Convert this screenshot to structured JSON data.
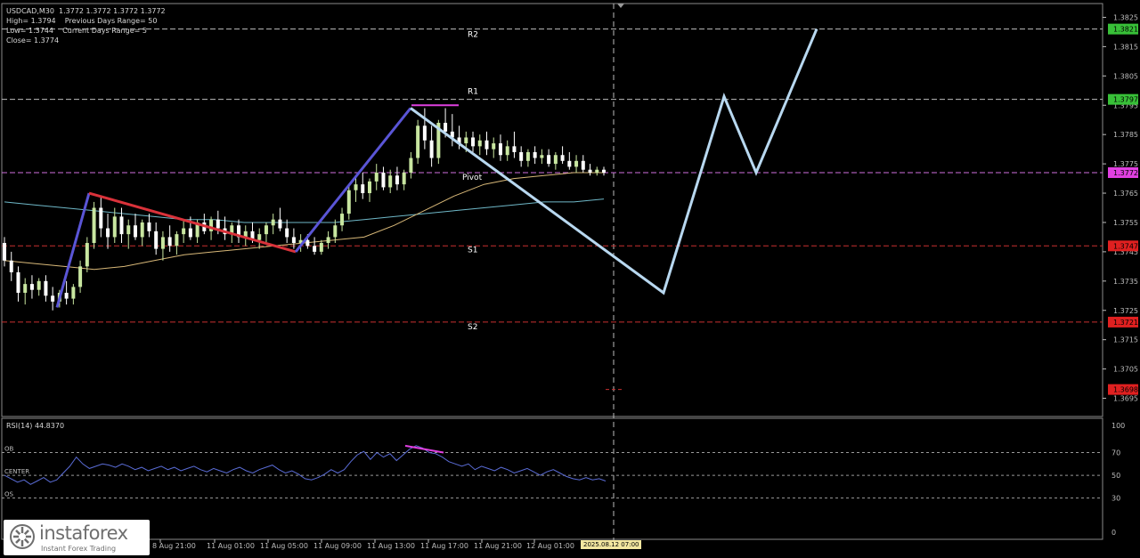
{
  "header": {
    "symbol_line": "USDCAD,M30  1.3772 1.3772 1.3772 1.3772",
    "high_line": "High= 1.3794    Previous Days Range= 50",
    "low_line": "Low= 1.3744    Current Days Range= 5",
    "close_line": "Close= 1.3774"
  },
  "rsi_label": "RSI(14) 44.8370",
  "time_badge": "2025.08.12 07:00",
  "watermark": {
    "name": "instaforex",
    "tagline": "Instant Forex Trading"
  },
  "colors": {
    "background": "#000000",
    "bull_candle": "#c8e6a0",
    "bear_candle": "#ffffff",
    "wave_up": "#5a55d6",
    "wave_down": "#d9323a",
    "projection": "#b8d8f0",
    "ma_fast": "#d8b878",
    "ma_slow": "#6fb8c8",
    "rsi_line": "#5a6cd6",
    "divergence": "#e040e0",
    "support_line": "#c83030",
    "resistance_line": "#d0d0d0",
    "pivot_line": "#d070e0"
  },
  "chart_data": [
    {
      "type": "candlestick",
      "title": "USDCAD,M30",
      "ylim": [
        1.369,
        1.383
      ],
      "y_ticks": [
        "1.3825",
        "1.3815",
        "1.3805",
        "1.3795",
        "1.3785",
        "1.3775",
        "1.3765",
        "1.3755",
        "1.3745",
        "1.3735",
        "1.3725",
        "1.3715",
        "1.3705",
        "1.3695"
      ],
      "price_tags": [
        {
          "label": "1.3821",
          "value": 1.3821,
          "kind": "green"
        },
        {
          "label": "1.3797",
          "value": 1.3797,
          "kind": "green"
        },
        {
          "label": "1.3772",
          "value": 1.3772,
          "kind": "magenta"
        },
        {
          "label": "1.3747",
          "value": 1.3747,
          "kind": "red"
        },
        {
          "label": "1.3721",
          "value": 1.3721,
          "kind": "red"
        },
        {
          "label": "1.3698",
          "value": 1.3698,
          "kind": "red"
        }
      ],
      "levels": [
        {
          "name": "R2",
          "value": 1.3821
        },
        {
          "name": "R1",
          "value": 1.3797
        },
        {
          "name": "Pivot",
          "value": 1.3772
        },
        {
          "name": "S1",
          "value": 1.3747
        },
        {
          "name": "S2",
          "value": 1.3721
        }
      ],
      "x_labels": [
        "8 Aug 21:00",
        "11 Aug 01:00",
        "11 Aug 05:00",
        "11 Aug 09:00",
        "11 Aug 13:00",
        "11 Aug 17:00",
        "11 Aug 21:00",
        "12 Aug 01:00"
      ],
      "candles": [
        [
          1.3748,
          1.375,
          1.374,
          1.3742
        ],
        [
          1.3742,
          1.3745,
          1.3735,
          1.3738
        ],
        [
          1.3738,
          1.374,
          1.3728,
          1.3731
        ],
        [
          1.3731,
          1.3736,
          1.3727,
          1.3734
        ],
        [
          1.3734,
          1.3737,
          1.3729,
          1.3732
        ],
        [
          1.3732,
          1.3736,
          1.373,
          1.3735
        ],
        [
          1.3735,
          1.3737,
          1.3728,
          1.373
        ],
        [
          1.373,
          1.3733,
          1.3725,
          1.3728
        ],
        [
          1.3728,
          1.3732,
          1.3726,
          1.3731
        ],
        [
          1.3731,
          1.3735,
          1.3727,
          1.3729
        ],
        [
          1.3729,
          1.3734,
          1.3727,
          1.3733
        ],
        [
          1.3733,
          1.3742,
          1.3731,
          1.374
        ],
        [
          1.374,
          1.375,
          1.3738,
          1.3748
        ],
        [
          1.3748,
          1.3762,
          1.3746,
          1.376
        ],
        [
          1.376,
          1.3764,
          1.375,
          1.3753
        ],
        [
          1.3753,
          1.3758,
          1.3746,
          1.375
        ],
        [
          1.375,
          1.376,
          1.3748,
          1.3757
        ],
        [
          1.3757,
          1.376,
          1.3748,
          1.3751
        ],
        [
          1.3751,
          1.3756,
          1.3746,
          1.3754
        ],
        [
          1.3754,
          1.3758,
          1.3749,
          1.375
        ],
        [
          1.375,
          1.3756,
          1.3747,
          1.3755
        ],
        [
          1.3755,
          1.3758,
          1.375,
          1.3752
        ],
        [
          1.3752,
          1.3755,
          1.3744,
          1.3746
        ],
        [
          1.3746,
          1.3752,
          1.3742,
          1.375
        ],
        [
          1.375,
          1.3754,
          1.3745,
          1.3747
        ],
        [
          1.3747,
          1.3752,
          1.3744,
          1.3751
        ],
        [
          1.3751,
          1.3756,
          1.3748,
          1.3753
        ],
        [
          1.3753,
          1.3757,
          1.3749,
          1.375
        ],
        [
          1.375,
          1.3756,
          1.3748,
          1.3755
        ],
        [
          1.3755,
          1.3758,
          1.3751,
          1.3752
        ],
        [
          1.3752,
          1.3757,
          1.3749,
          1.3756
        ],
        [
          1.3756,
          1.3759,
          1.3751,
          1.3753
        ],
        [
          1.3753,
          1.3757,
          1.3749,
          1.3751
        ],
        [
          1.3751,
          1.3755,
          1.3748,
          1.3754
        ],
        [
          1.3754,
          1.3756,
          1.3748,
          1.375
        ],
        [
          1.375,
          1.3754,
          1.3747,
          1.3752
        ],
        [
          1.3752,
          1.3755,
          1.3748,
          1.3749
        ],
        [
          1.3749,
          1.3753,
          1.3746,
          1.3751
        ],
        [
          1.3751,
          1.3755,
          1.3748,
          1.3754
        ],
        [
          1.3754,
          1.3758,
          1.3751,
          1.3756
        ],
        [
          1.3756,
          1.376,
          1.3752,
          1.3753
        ],
        [
          1.3753,
          1.3756,
          1.3748,
          1.375
        ],
        [
          1.375,
          1.3753,
          1.3746,
          1.3748
        ],
        [
          1.3748,
          1.3751,
          1.3745,
          1.3749
        ],
        [
          1.3749,
          1.3751,
          1.3746,
          1.3747
        ],
        [
          1.3747,
          1.375,
          1.3744,
          1.3745
        ],
        [
          1.3745,
          1.3749,
          1.3744,
          1.3748
        ],
        [
          1.3748,
          1.3752,
          1.3746,
          1.375
        ],
        [
          1.375,
          1.3756,
          1.3748,
          1.3754
        ],
        [
          1.3754,
          1.376,
          1.3752,
          1.3758
        ],
        [
          1.3758,
          1.3768,
          1.3756,
          1.3766
        ],
        [
          1.3766,
          1.3771,
          1.3762,
          1.3768
        ],
        [
          1.3768,
          1.3772,
          1.3763,
          1.3765
        ],
        [
          1.3765,
          1.377,
          1.3762,
          1.3769
        ],
        [
          1.3769,
          1.3775,
          1.3766,
          1.3772
        ],
        [
          1.3772,
          1.3774,
          1.3766,
          1.3767
        ],
        [
          1.3767,
          1.3773,
          1.3765,
          1.3771
        ],
        [
          1.3771,
          1.3774,
          1.3766,
          1.3768
        ],
        [
          1.3768,
          1.3773,
          1.3766,
          1.3772
        ],
        [
          1.3772,
          1.3779,
          1.377,
          1.3777
        ],
        [
          1.3777,
          1.379,
          1.3775,
          1.3788
        ],
        [
          1.3788,
          1.3794,
          1.378,
          1.3783
        ],
        [
          1.3783,
          1.3788,
          1.3774,
          1.3777
        ],
        [
          1.3777,
          1.379,
          1.3775,
          1.3789
        ],
        [
          1.3789,
          1.3794,
          1.3784,
          1.3786
        ],
        [
          1.3786,
          1.3792,
          1.3781,
          1.3784
        ],
        [
          1.3784,
          1.3788,
          1.378,
          1.3782
        ],
        [
          1.3782,
          1.3786,
          1.3779,
          1.3784
        ],
        [
          1.3784,
          1.3786,
          1.3779,
          1.3781
        ],
        [
          1.3781,
          1.3785,
          1.3778,
          1.3783
        ],
        [
          1.3783,
          1.3786,
          1.3778,
          1.378
        ],
        [
          1.378,
          1.3784,
          1.3777,
          1.3782
        ],
        [
          1.3782,
          1.3785,
          1.3776,
          1.3778
        ],
        [
          1.3778,
          1.3783,
          1.3776,
          1.3781
        ],
        [
          1.3781,
          1.3786,
          1.3777,
          1.3779
        ],
        [
          1.3779,
          1.3781,
          1.3774,
          1.3776
        ],
        [
          1.3776,
          1.378,
          1.3774,
          1.3779
        ],
        [
          1.3779,
          1.3781,
          1.3775,
          1.3777
        ],
        [
          1.3777,
          1.378,
          1.3775,
          1.3778
        ],
        [
          1.3778,
          1.378,
          1.3774,
          1.3775
        ],
        [
          1.3775,
          1.3779,
          1.3773,
          1.3778
        ],
        [
          1.3778,
          1.3781,
          1.3775,
          1.3776
        ],
        [
          1.3776,
          1.3779,
          1.3773,
          1.3774
        ],
        [
          1.3774,
          1.3778,
          1.3772,
          1.3776
        ],
        [
          1.3776,
          1.3778,
          1.3772,
          1.3773
        ],
        [
          1.3773,
          1.3775,
          1.3771,
          1.3772
        ],
        [
          1.3772,
          1.3774,
          1.3771,
          1.3773
        ],
        [
          1.3773,
          1.3774,
          1.3771,
          1.3772
        ]
      ],
      "ma_fast": [
        1.3742,
        1.3741,
        1.374,
        1.3739,
        1.374,
        1.3742,
        1.3744,
        1.3745,
        1.3746,
        1.3747,
        1.3748,
        1.3749,
        1.375,
        1.3754,
        1.3759,
        1.3764,
        1.3768,
        1.377,
        1.3771,
        1.3772,
        1.3772
      ],
      "ma_slow": [
        1.3762,
        1.3761,
        1.376,
        1.3759,
        1.3758,
        1.3757,
        1.3756,
        1.3756,
        1.3755,
        1.3755,
        1.3755,
        1.3755,
        1.3756,
        1.3757,
        1.3758,
        1.3759,
        1.376,
        1.3761,
        1.3762,
        1.3762,
        1.3763
      ],
      "wave_points": [
        {
          "bar": 15,
          "price": 1.3726,
          "leg": "up"
        },
        {
          "bar": 24,
          "price": 1.3765,
          "leg": "down"
        },
        {
          "bar": 79,
          "price": 1.3745,
          "leg": "up"
        },
        {
          "bar": 110,
          "price": 1.3794,
          "leg": "end"
        }
      ],
      "projection": [
        {
          "step": 0,
          "price": 1.3794
        },
        {
          "step": 1,
          "price": 1.3731
        },
        {
          "step": 2,
          "price": 1.3798
        },
        {
          "step": 3,
          "price": 1.3772
        },
        {
          "step": 4,
          "price": 1.3821
        }
      ]
    },
    {
      "type": "line",
      "title": "RSI(14) 44.8370",
      "ylim": [
        0,
        100
      ],
      "y_ticks": [
        "100",
        "70",
        "50",
        "30",
        "0"
      ],
      "levels": [
        {
          "name": "OB",
          "value": 70
        },
        {
          "name": "CENTER",
          "value": 50
        },
        {
          "name": "OS",
          "value": 30
        }
      ],
      "values": [
        50,
        47,
        44,
        46,
        42,
        45,
        48,
        44,
        46,
        52,
        58,
        66,
        60,
        56,
        58,
        60,
        59,
        57,
        60,
        58,
        55,
        57,
        54,
        56,
        58,
        55,
        57,
        54,
        56,
        58,
        55,
        53,
        56,
        54,
        52,
        55,
        57,
        54,
        52,
        55,
        57,
        59,
        55,
        52,
        54,
        51,
        47,
        46,
        48,
        51,
        55,
        52,
        55,
        62,
        68,
        71,
        64,
        70,
        66,
        69,
        63,
        68,
        73,
        76,
        74,
        70,
        69,
        66,
        62,
        60,
        58,
        60,
        55,
        58,
        56,
        54,
        57,
        55,
        52,
        54,
        56,
        53,
        50,
        53,
        55,
        52,
        49,
        47,
        46,
        48,
        46,
        47,
        45
      ]
    }
  ]
}
